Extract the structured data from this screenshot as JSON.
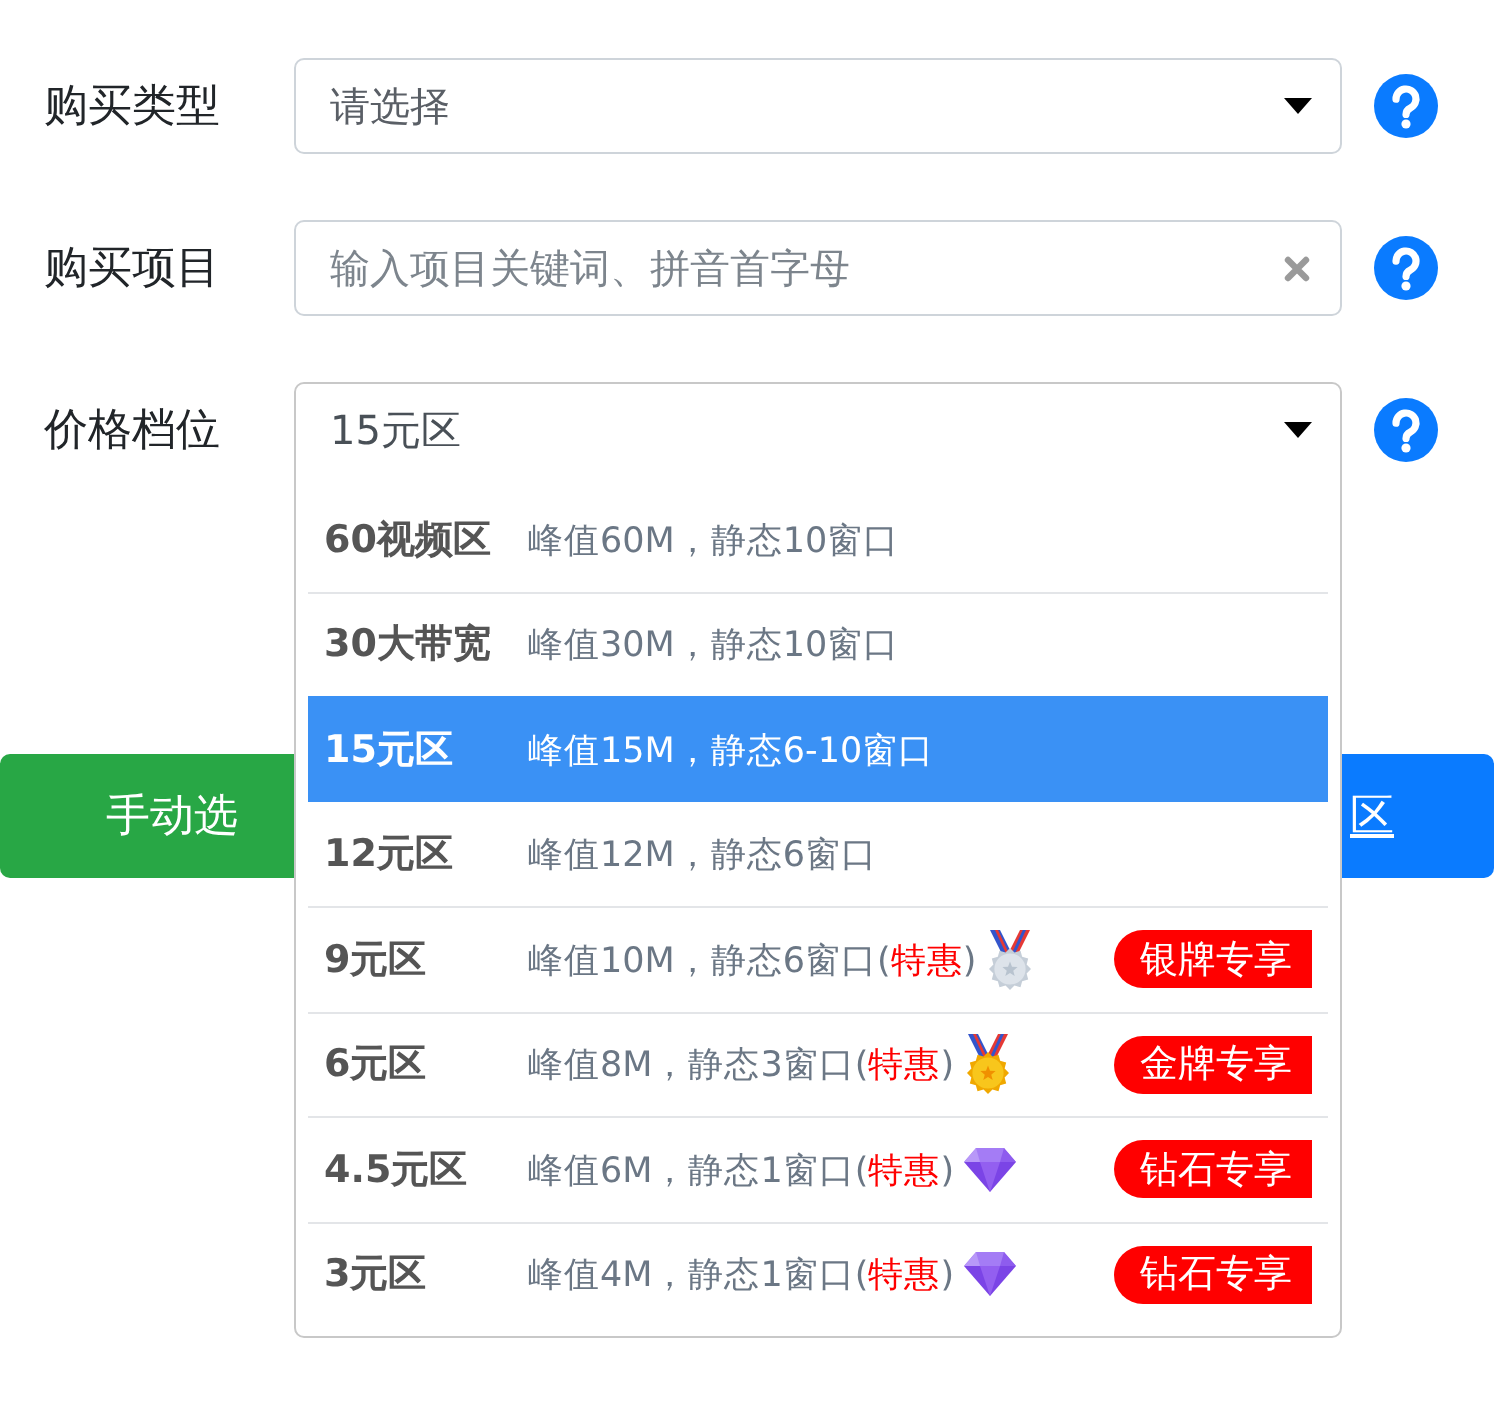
{
  "form": {
    "fields": [
      {
        "kind": "select",
        "label": "购买类型",
        "placeholder": "请选择",
        "open": false
      },
      {
        "kind": "search",
        "label": "购买项目",
        "placeholder": "输入项目关键词、拼音首字母"
      },
      {
        "kind": "select",
        "label": "价格档位",
        "value": "15元区",
        "open": true,
        "options": [
          {
            "kind": "plain",
            "name": "60视频区",
            "desc": [
              {
                "text": "峰值60M，静态10窗口",
                "emphasis": false
              }
            ],
            "selected": false
          },
          {
            "kind": "plain",
            "name": "30大带宽",
            "desc": [
              {
                "text": "峰值30M，静态10窗口",
                "emphasis": false
              }
            ],
            "selected": false
          },
          {
            "kind": "plain",
            "name": "15元区",
            "desc": [
              {
                "text": "峰值15M，静态6-10窗口",
                "emphasis": false
              }
            ],
            "selected": true
          },
          {
            "kind": "plain",
            "name": "12元区",
            "desc": [
              {
                "text": "峰值12M，静态6窗口",
                "emphasis": false
              }
            ],
            "selected": false
          },
          {
            "kind": "silver_medal",
            "name": "9元区",
            "desc": [
              {
                "text": "峰值10M，静态6窗口(",
                "emphasis": false
              },
              {
                "text": "特惠",
                "emphasis": true
              },
              {
                "text": ")",
                "emphasis": false
              }
            ],
            "badge": "银牌专享",
            "selected": false
          },
          {
            "kind": "gold_medal",
            "name": "6元区",
            "desc": [
              {
                "text": "峰值8M，静态3窗口(",
                "emphasis": false
              },
              {
                "text": "特惠",
                "emphasis": true
              },
              {
                "text": ")",
                "emphasis": false
              }
            ],
            "badge": "金牌专享",
            "selected": false
          },
          {
            "kind": "diamond",
            "name": "4.5元区",
            "desc": [
              {
                "text": "峰值6M，静态1窗口(",
                "emphasis": false
              },
              {
                "text": "特惠",
                "emphasis": true
              },
              {
                "text": ")",
                "emphasis": false
              }
            ],
            "badge": "钻石专享",
            "selected": false
          },
          {
            "kind": "diamond",
            "name": "3元区",
            "desc": [
              {
                "text": "峰值4M，静态1窗口(",
                "emphasis": false
              },
              {
                "text": "特惠",
                "emphasis": true
              },
              {
                "text": ")",
                "emphasis": false
              }
            ],
            "badge": "钻石专享",
            "selected": false
          }
        ]
      }
    ]
  },
  "buttons": [
    {
      "kind": "success",
      "label": "手动选"
    },
    {
      "kind": "primary",
      "label": "区"
    }
  ]
}
